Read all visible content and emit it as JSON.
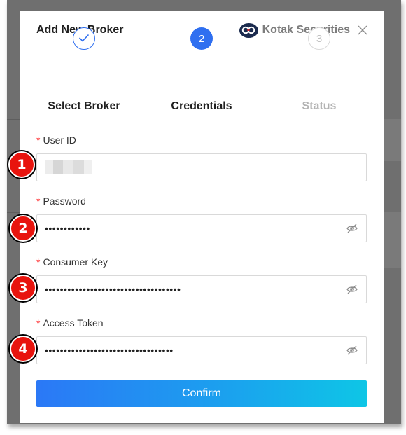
{
  "modal": {
    "title": "Add New Broker",
    "brand_name": "Kotak Securities",
    "brand_icon": "kotak-logo-icon",
    "close_icon": "close-icon"
  },
  "steps": [
    {
      "label": "Select Broker",
      "number": "1",
      "state": "done"
    },
    {
      "label": "Credentials",
      "number": "2",
      "state": "active"
    },
    {
      "label": "Status",
      "number": "3",
      "state": "pending"
    }
  ],
  "fields": {
    "user_id": {
      "label": "User ID",
      "required_mark": "*",
      "value": ""
    },
    "password": {
      "label": "Password",
      "required_mark": "*",
      "value": "••••••••••••"
    },
    "consumer_key": {
      "label": "Consumer Key",
      "required_mark": "*",
      "value": "••••••••••••••••••••••••••••••••••••"
    },
    "access_token": {
      "label": "Access Token",
      "required_mark": "*",
      "value": "••••••••••••••••••••••••••••••••••"
    }
  },
  "confirm_label": "Confirm",
  "badges": [
    "1",
    "2",
    "3",
    "4"
  ],
  "colors": {
    "accent": "#2f6ff0",
    "required": "#ff4d4f",
    "badge": "#e8140e",
    "button_gradient_start": "#2b78f6",
    "button_gradient_end": "#0ec6e6"
  }
}
